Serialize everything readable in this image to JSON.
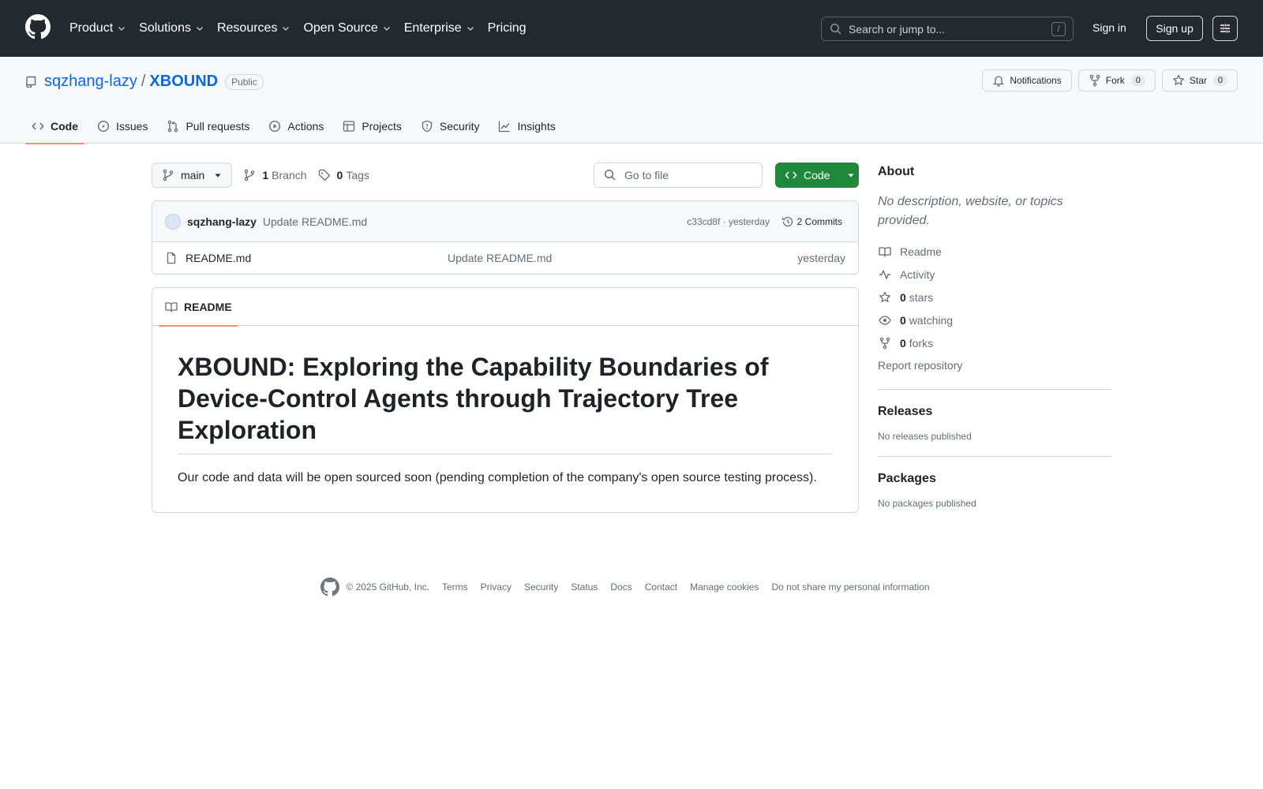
{
  "header": {
    "nav": [
      {
        "label": "Product",
        "dropdown": true
      },
      {
        "label": "Solutions",
        "dropdown": true
      },
      {
        "label": "Resources",
        "dropdown": true
      },
      {
        "label": "Open Source",
        "dropdown": true
      },
      {
        "label": "Enterprise",
        "dropdown": true
      },
      {
        "label": "Pricing",
        "dropdown": false
      }
    ],
    "search_placeholder": "Search or jump to...",
    "search_shortcut": "/",
    "sign_in": "Sign in",
    "sign_up": "Sign up"
  },
  "repo": {
    "owner": "sqzhang-lazy",
    "separator": "/",
    "name": "XBOUND",
    "visibility": "Public",
    "actions": {
      "notifications": "Notifications",
      "fork": "Fork",
      "fork_count": "0",
      "star": "Star",
      "star_count": "0"
    },
    "tabs": [
      {
        "label": "Code",
        "icon": "code-icon"
      },
      {
        "label": "Issues",
        "icon": "issue-icon"
      },
      {
        "label": "Pull requests",
        "icon": "pull-request-icon"
      },
      {
        "label": "Actions",
        "icon": "play-icon"
      },
      {
        "label": "Projects",
        "icon": "table-icon"
      },
      {
        "label": "Security",
        "icon": "shield-icon"
      },
      {
        "label": "Insights",
        "icon": "graph-icon"
      }
    ]
  },
  "code": {
    "branch": "main",
    "branch_count": "1",
    "branch_label": "Branch",
    "tag_count": "0",
    "tag_label": "Tags",
    "goto_placeholder": "Go to file",
    "code_button": "Code",
    "commit": {
      "author": "sqzhang-lazy",
      "message": "Update README.md",
      "meta": "c33cd8f · yesterday",
      "count": "2 Commits"
    },
    "files": [
      {
        "name": "README.md",
        "message": "Update README.md",
        "date": "yesterday"
      }
    ]
  },
  "readme": {
    "tab": "README",
    "title": "XBOUND: Exploring the Capability Boundaries of Device-Control Agents through Trajectory Tree Exploration",
    "body": "Our code and data will be open sourced soon (pending completion of the company's open source testing process)."
  },
  "sidebar": {
    "about_title": "About",
    "about_desc": "No description, website, or topics provided.",
    "items": {
      "readme": "Readme",
      "activity": "Activity",
      "stars_count": "0",
      "stars_label": "stars",
      "watching_count": "0",
      "watching_label": "watching",
      "forks_count": "0",
      "forks_label": "forks"
    },
    "report": "Report repository",
    "releases_title": "Releases",
    "releases_empty": "No releases published",
    "packages_title": "Packages",
    "packages_empty": "No packages published"
  },
  "footer": {
    "copyright": "© 2025 GitHub, Inc.",
    "links": [
      "Terms",
      "Privacy",
      "Security",
      "Status",
      "Docs",
      "Contact",
      "Manage cookies",
      "Do not share my personal information"
    ]
  },
  "colors": {
    "header_bg": "#24292f",
    "link": "#0969da",
    "primary_button": "#1f883d",
    "tab_underline": "#fd8c73"
  }
}
